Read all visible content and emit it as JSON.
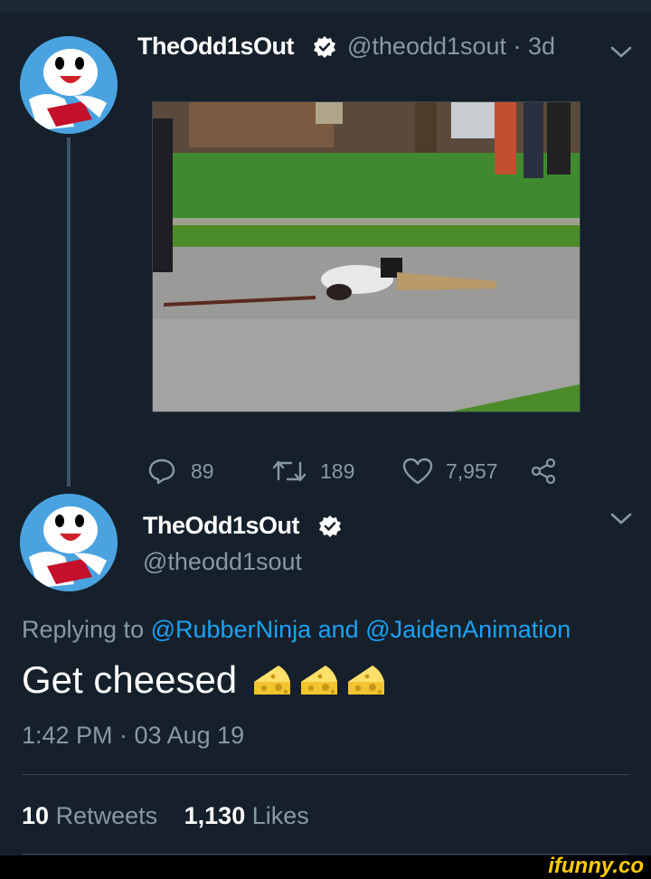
{
  "colors": {
    "background": "#15202b",
    "link": "#1da1f2",
    "muted": "#8899a6",
    "verified": "#ffffff",
    "watermark": "#ffcc00"
  },
  "parent_tweet": {
    "display_name": "TheOdd1sOut",
    "handle_time": "@theodd1sout · 3d",
    "icons": [
      "avatar",
      "verified-icon",
      "chevron-down-icon"
    ],
    "media_description": "photo",
    "actions": {
      "reply_count": "89",
      "retweet_count": "189",
      "like_count": "7,957"
    }
  },
  "main_tweet": {
    "display_name": "TheOdd1sOut",
    "handle": "@theodd1sout",
    "replying_prefix": "Replying to",
    "mention_1": "@RubberNinja",
    "and_word": "and",
    "mention_2": "@JaidenAnimation",
    "text": "Get cheesed",
    "emoji": [
      "cheese",
      "cheese",
      "cheese"
    ],
    "timestamp": "1:42 PM · 03 Aug 19",
    "retweets_count": "10",
    "retweets_label": "Retweets",
    "likes_count": "1,130",
    "likes_label": "Likes"
  },
  "watermark": "ifunny.co"
}
